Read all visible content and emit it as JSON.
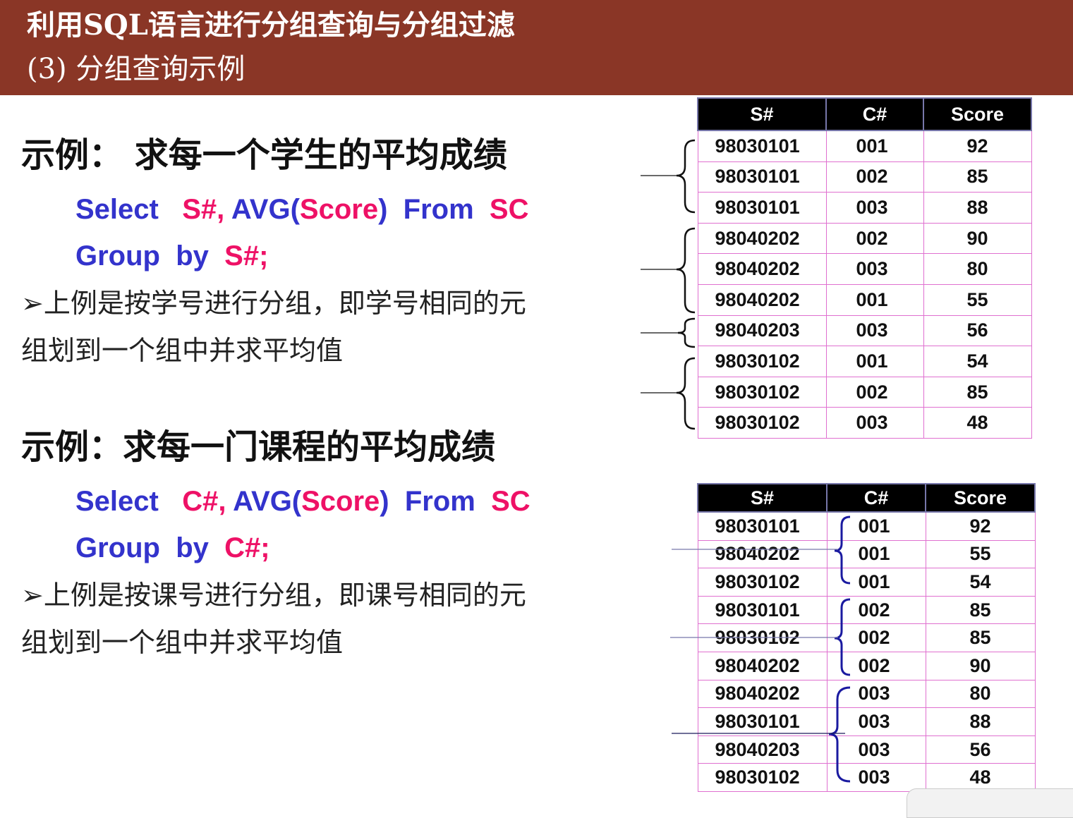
{
  "header": {
    "title": "利用SQL语言进行分组查询与分组过滤",
    "subtitle": "(3) 分组查询示例"
  },
  "example1": {
    "heading": "示例： 求每一个学生的平均成绩",
    "line1": {
      "kw_select": "Select",
      "cols": "S#,",
      "avg": "AVG(",
      "score": "Score",
      "close": ")",
      "kw_from": "From",
      "table": "SC"
    },
    "line2": {
      "kw_group": "Group",
      "kw_by": "by",
      "col": "S#;"
    },
    "bullet_line1": "➢上例是按学号进行分组，即学号相同的元",
    "bullet_line2": "组划到一个组中并求平均值"
  },
  "example2": {
    "heading": "示例：求每一门课程的平均成绩",
    "line1": {
      "kw_select": "Select",
      "cols": "C#,",
      "avg": "AVG(",
      "score": "Score",
      "close": ")",
      "kw_from": "From",
      "table": "SC"
    },
    "line2": {
      "kw_group": "Group",
      "kw_by": "by",
      "col": "C#;"
    },
    "bullet_line1": "➢上例是按课号进行分组，即课号相同的元",
    "bullet_line2": "组划到一个组中并求平均值"
  },
  "table1": {
    "headers": [
      "S#",
      "C#",
      "Score"
    ],
    "rows": [
      [
        "98030101",
        "001",
        "92"
      ],
      [
        "98030101",
        "002",
        "85"
      ],
      [
        "98030101",
        "003",
        "88"
      ],
      [
        "98040202",
        "002",
        "90"
      ],
      [
        "98040202",
        "003",
        "80"
      ],
      [
        "98040202",
        "001",
        "55"
      ],
      [
        "98040203",
        "003",
        "56"
      ],
      [
        "98030102",
        "001",
        "54"
      ],
      [
        "98030102",
        "002",
        "85"
      ],
      [
        "98030102",
        "003",
        "48"
      ]
    ]
  },
  "table2": {
    "headers": [
      "S#",
      "C#",
      "Score"
    ],
    "rows": [
      [
        "98030101",
        "001",
        "92"
      ],
      [
        "98040202",
        "001",
        "55"
      ],
      [
        "98030102",
        "001",
        "54"
      ],
      [
        "98030101",
        "002",
        "85"
      ],
      [
        "98030102",
        "002",
        "85"
      ],
      [
        "98040202",
        "002",
        "90"
      ],
      [
        "98040202",
        "003",
        "80"
      ],
      [
        "98030101",
        "003",
        "88"
      ],
      [
        "98040203",
        "003",
        "56"
      ],
      [
        "98030102",
        "003",
        "48"
      ]
    ]
  },
  "colors": {
    "header_bg": "#8a3626",
    "keyword": "#3333cc",
    "identifier": "#ee1166",
    "cell_border": "#e070d0",
    "brace_black": "#111111",
    "brace_blue": "#1a1aa0"
  }
}
